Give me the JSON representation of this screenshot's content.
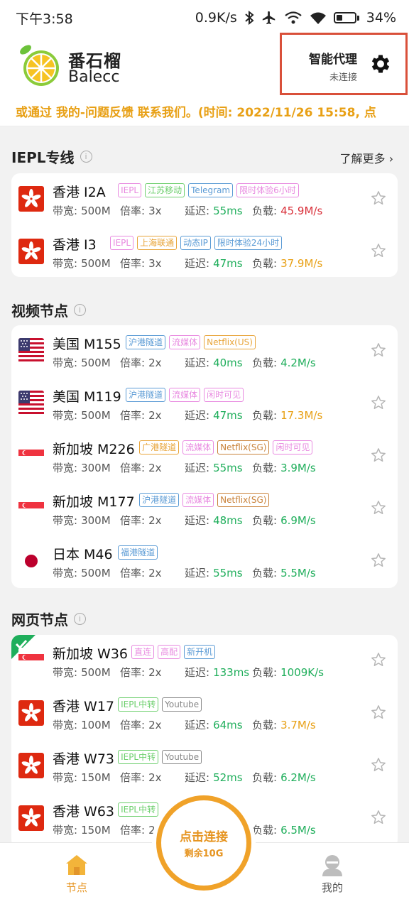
{
  "status_bar": {
    "time": "下午3:58",
    "speed": "0.9K/s",
    "battery": "34%",
    "battery_level": 0.34
  },
  "header": {
    "brand_cn": "番石榴",
    "brand_en": "Balecc",
    "proxy_title": "智能代理",
    "proxy_status": "未连接"
  },
  "marquee": "或通过 我的-问题反馈 联系我们。(时间: 2022/11/26 15:58, 点",
  "labels": {
    "bandwidth": "带宽:",
    "multiplier": "倍率:",
    "latency": "延迟:",
    "load": "负载:"
  },
  "sections": [
    {
      "title": "IEPL专线",
      "more": "了解更多",
      "nodes": [
        {
          "flag": "hk",
          "name": "香港 I2A",
          "tags": [
            {
              "t": "IEPL",
              "c": "#e889e0"
            },
            {
              "t": "江苏移动",
              "c": "#6dcf6d"
            },
            {
              "t": "Telegram",
              "c": "#5b9bd5"
            },
            {
              "t": "限时体验6小时",
              "c": "#e889e0"
            }
          ],
          "bw": "500M",
          "mult": "3x",
          "lat": "55ms",
          "load": "45.9M/s",
          "load_color": "#d9303a",
          "fav": false
        },
        {
          "flag": "hk",
          "name": "香港 I3",
          "tags": [
            {
              "t": "IEPL",
              "c": "#e889e0"
            },
            {
              "t": "上海联通",
              "c": "#e8a53a"
            },
            {
              "t": "动态IP",
              "c": "#5b9bd5"
            },
            {
              "t": "限时体验24小时",
              "c": "#5b9bd5"
            }
          ],
          "bw": "500M",
          "mult": "3x",
          "lat": "47ms",
          "load": "37.9M/s",
          "load_color": "#e8a015",
          "fav": false
        }
      ]
    },
    {
      "title": "视频节点",
      "nodes": [
        {
          "flag": "us",
          "name": "美国 M155",
          "tags": [
            {
              "t": "沪港隧道",
              "c": "#5b9bd5"
            },
            {
              "t": "流媒体",
              "c": "#e889e0"
            },
            {
              "t": "Netflix(US)",
              "c": "#e8a53a"
            }
          ],
          "bw": "500M",
          "mult": "2x",
          "lat": "40ms",
          "load": "4.2M/s",
          "load_color": "#1fae5b",
          "fav": false
        },
        {
          "flag": "us",
          "name": "美国 M119",
          "tags": [
            {
              "t": "沪港隧道",
              "c": "#5b9bd5"
            },
            {
              "t": "流媒体",
              "c": "#e889e0"
            },
            {
              "t": "闲时可见",
              "c": "#e889e0"
            }
          ],
          "bw": "500M",
          "mult": "2x",
          "lat": "47ms",
          "load": "17.3M/s",
          "load_color": "#e8a015",
          "fav": false
        },
        {
          "flag": "sg",
          "name": "新加坡 M226",
          "tags": [
            {
              "t": "广港隧道",
              "c": "#e8a53a"
            },
            {
              "t": "流媒体",
              "c": "#e889e0"
            },
            {
              "t": "Netflix(SG)",
              "c": "#c9823a"
            },
            {
              "t": "闲时可见",
              "c": "#e889e0"
            }
          ],
          "bw": "300M",
          "mult": "2x",
          "lat": "55ms",
          "load": "3.9M/s",
          "load_color": "#1fae5b",
          "fav": false
        },
        {
          "flag": "sg",
          "name": "新加坡 M177",
          "tags": [
            {
              "t": "沪港隧道",
              "c": "#5b9bd5"
            },
            {
              "t": "流媒体",
              "c": "#e889e0"
            },
            {
              "t": "Netflix(SG)",
              "c": "#c9823a"
            }
          ],
          "bw": "300M",
          "mult": "2x",
          "lat": "48ms",
          "load": "6.9M/s",
          "load_color": "#1fae5b",
          "fav": false
        },
        {
          "flag": "jp",
          "name": "日本 M46",
          "tags": [
            {
              "t": "福港隧道",
              "c": "#5b9bd5"
            }
          ],
          "bw": "500M",
          "mult": "2x",
          "lat": "55ms",
          "load": "5.5M/s",
          "load_color": "#1fae5b",
          "fav": false
        }
      ]
    },
    {
      "title": "网页节点",
      "nodes": [
        {
          "flag": "sg",
          "name": "新加坡 W36",
          "tags": [
            {
              "t": "直连",
              "c": "#e889e0"
            },
            {
              "t": "高配",
              "c": "#e889e0"
            },
            {
              "t": "新开机",
              "c": "#5b9bd5"
            }
          ],
          "bw": "500M",
          "mult": "2x",
          "lat": "133ms",
          "load": "1009K/s",
          "load_color": "#1fae5b",
          "fav": false,
          "selected": true
        },
        {
          "flag": "hk",
          "name": "香港 W17",
          "tags": [
            {
              "t": "IEPL中转",
              "c": "#6dcf6d"
            },
            {
              "t": "Youtube",
              "c": "#888888"
            }
          ],
          "bw": "100M",
          "mult": "2x",
          "lat": "64ms",
          "load": "3.7M/s",
          "load_color": "#e8a015",
          "fav": false
        },
        {
          "flag": "hk",
          "name": "香港 W73",
          "tags": [
            {
              "t": "IEPL中转",
              "c": "#6dcf6d"
            },
            {
              "t": "Youtube",
              "c": "#888888"
            }
          ],
          "bw": "150M",
          "mult": "2x",
          "lat": "52ms",
          "load": "6.2M/s",
          "load_color": "#1fae5b",
          "fav": false
        },
        {
          "flag": "hk",
          "name": "香港 W63",
          "tags": [
            {
              "t": "IEPL中转",
              "c": "#6dcf6d"
            }
          ],
          "bw": "150M",
          "mult": "2x",
          "lat": "",
          "load": "6.5M/s",
          "load_color": "#1fae5b",
          "fav": false
        }
      ]
    }
  ],
  "connect": {
    "main": "点击连接",
    "sub": "剩余10G"
  },
  "nav": {
    "nodes": "节点",
    "mine": "我的"
  },
  "colors": {
    "accent": "#f0a229",
    "good": "#1fae5b",
    "warn": "#e8a015",
    "bad": "#d9303a"
  }
}
